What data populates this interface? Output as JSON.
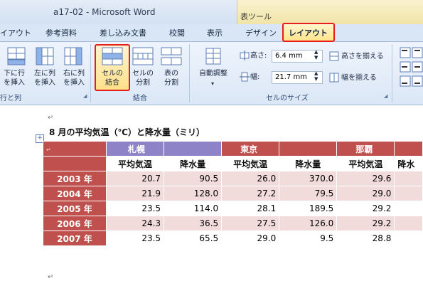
{
  "window": {
    "title": "a17-02 - Microsoft Word",
    "context_group": "表ツール"
  },
  "tabs": [
    {
      "label": "イアウト"
    },
    {
      "label": "参考資料"
    },
    {
      "label": "差し込み文書"
    },
    {
      "label": "校閲"
    },
    {
      "label": "表示"
    },
    {
      "label": "デザイン"
    },
    {
      "label": "レイアウト",
      "active": true
    }
  ],
  "ribbon": {
    "rows_cols": {
      "group_label": "行と列",
      "insert_below": [
        "下に行",
        "を挿入"
      ],
      "insert_left": [
        "左に列",
        "を挿入"
      ],
      "insert_right": [
        "右に列",
        "を挿入"
      ]
    },
    "merge": {
      "group_label": "結合",
      "merge_cells": [
        "セルの",
        "結合"
      ],
      "split_cells": [
        "セルの",
        "分割"
      ],
      "split_table": [
        "表の",
        "分割"
      ]
    },
    "cell_size": {
      "group_label": "セルのサイズ",
      "autofit": "自動調整",
      "height_label": "高さ:",
      "height_value": "6.4 mm",
      "width_label": "幅:",
      "width_value": "21.7 mm",
      "distribute_rows": "高さを揃える",
      "distribute_cols": "幅を揃える"
    }
  },
  "document": {
    "para_mark": "↵",
    "table_title": "8 月の平均気温（℃）と降水量（ミリ）",
    "cities": [
      "札幌",
      "東京",
      "那覇"
    ],
    "sub_headers": [
      "平均気温",
      "降水量",
      "平均気温",
      "降水量",
      "平均気温",
      "降水"
    ],
    "rows": [
      {
        "year": "2003 年",
        "values": [
          "20.7",
          "90.5",
          "26.0",
          "370.0",
          "29.6"
        ]
      },
      {
        "year": "2004 年",
        "values": [
          "21.9",
          "128.0",
          "27.2",
          "79.5",
          "29.0"
        ]
      },
      {
        "year": "2005 年",
        "values": [
          "23.5",
          "114.0",
          "28.1",
          "189.5",
          "29.2"
        ]
      },
      {
        "year": "2006 年",
        "values": [
          "24.3",
          "36.5",
          "27.5",
          "126.0",
          "29.2"
        ]
      },
      {
        "year": "2007 年",
        "values": [
          "23.5",
          "65.5",
          "29.0",
          "9.5",
          "28.8"
        ]
      }
    ]
  },
  "colors": {
    "accent": "#c0504d",
    "band": "#f2dcdb",
    "selection": "#8e83c6",
    "highlight": "#e81c1c"
  }
}
